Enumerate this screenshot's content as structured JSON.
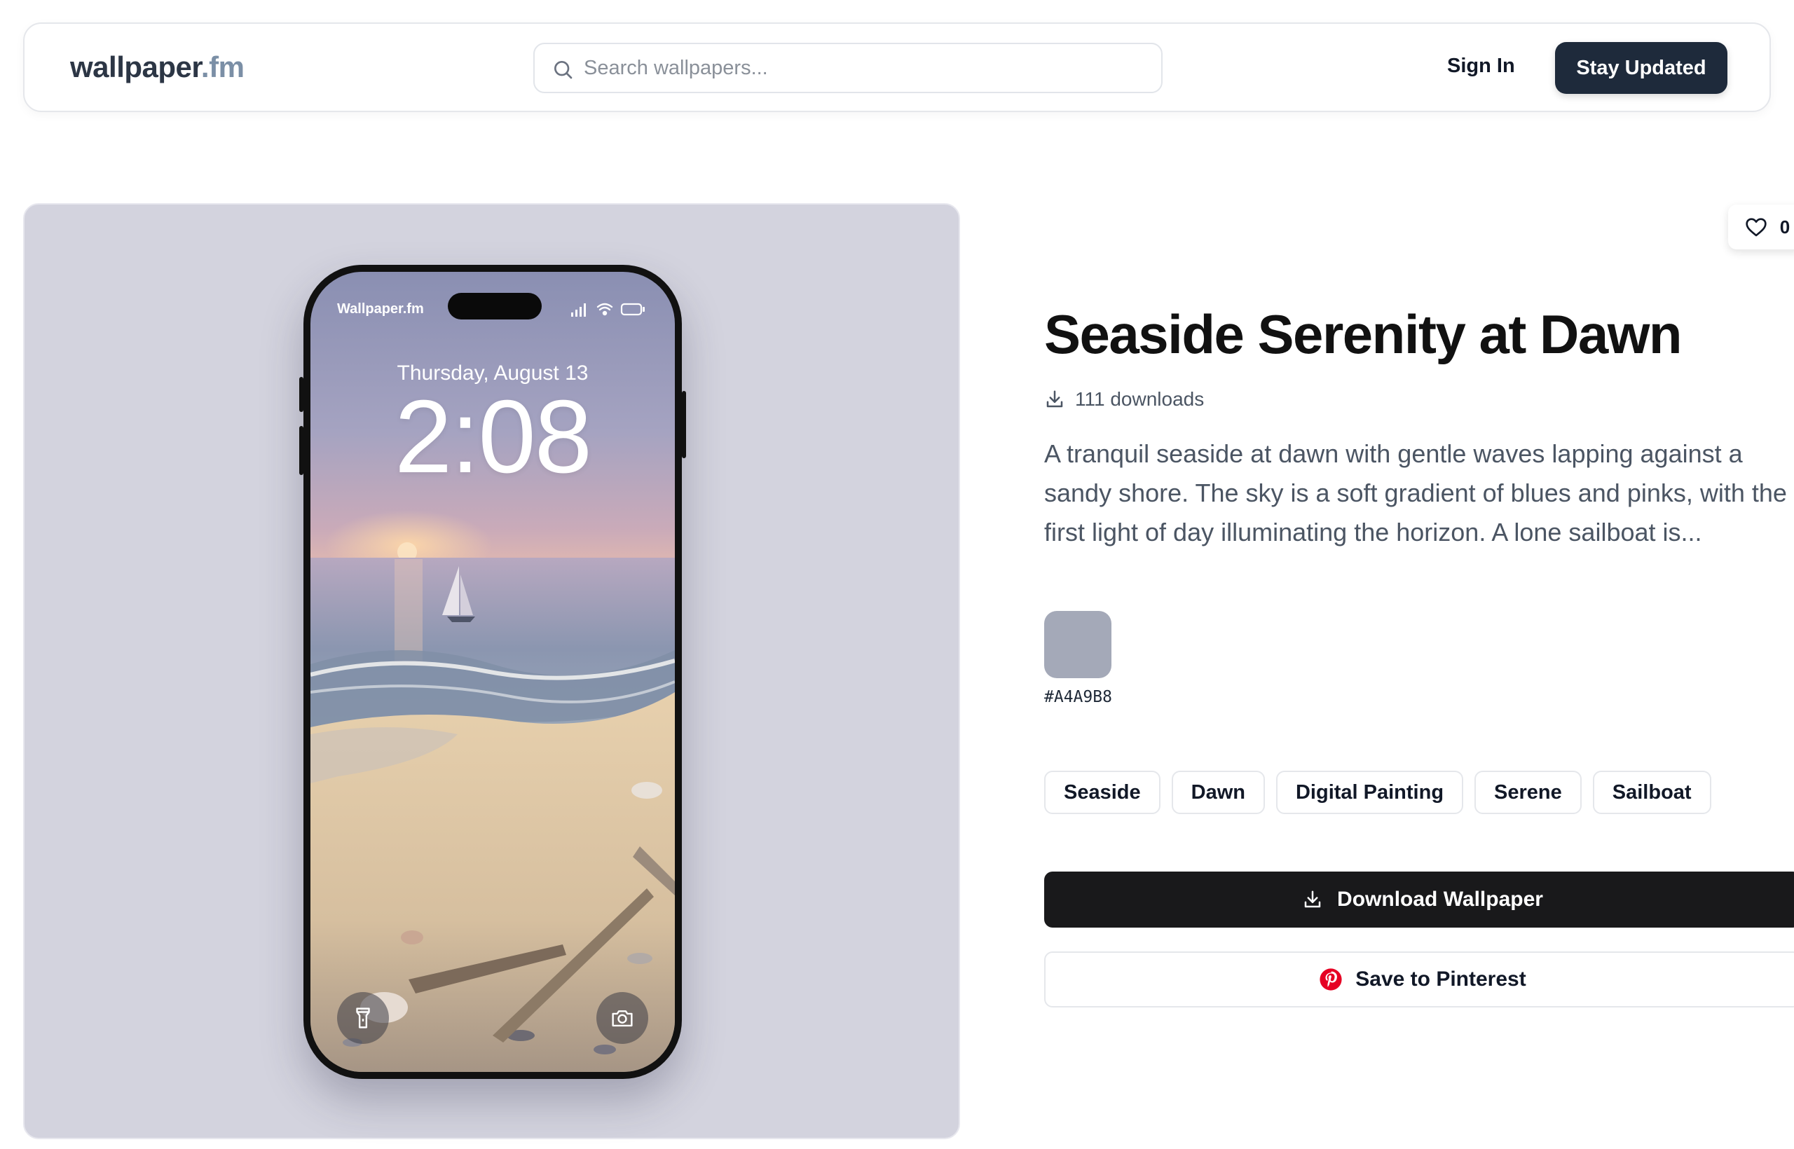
{
  "header": {
    "logo_main": "wallpaper",
    "logo_tld": ".fm",
    "search_placeholder": "Search wallpapers...",
    "signin_label": "Sign In",
    "cta_label": "Stay Updated"
  },
  "phone": {
    "brand": "Wallpaper.fm",
    "date": "Thursday, August 13",
    "time": "2:08"
  },
  "details": {
    "likes": "0",
    "title": "Seaside Serenity at Dawn",
    "downloads": "111 downloads",
    "description": "A tranquil seaside at dawn with gentle waves lapping against a sandy shore. The sky is a soft gradient of blues and pinks, with the first light of day illuminating the horizon. A lone sailboat is...",
    "color_hex": "#A4A9B8",
    "tags": [
      "Seaside",
      "Dawn",
      "Digital Painting",
      "Serene",
      "Sailboat"
    ],
    "download_label": "Download Wallpaper",
    "pinterest_label": "Save to Pinterest"
  },
  "colors": {
    "accent_dark": "#1e2a3b",
    "pinterest_red": "#e60023",
    "swatch": "#A4A9B8",
    "preview_bg": "#d3d3de"
  },
  "icons": {
    "search": "search-icon",
    "heart": "heart-icon",
    "download": "download-icon",
    "pinterest": "pinterest-icon",
    "flashlight": "flashlight-icon",
    "camera": "camera-icon"
  }
}
